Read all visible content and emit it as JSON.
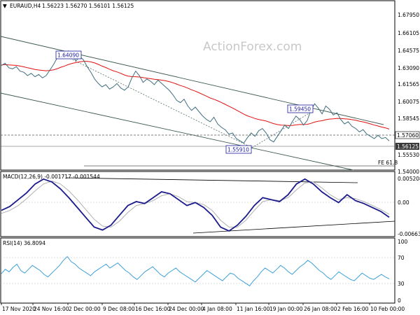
{
  "header": {
    "symbol": "EURAUD,H4",
    "ohlc": "1.56223 1.56270 1.56101 1.56125"
  },
  "watermark": "ActionForex.com",
  "colors": {
    "price": "#3f6e7e",
    "ma": "#e01010",
    "channel": "#3f5a52",
    "macd": "#1b1b8c",
    "signal": "#b0b0b0",
    "rsi": "#3ea0d8",
    "current_box": "#3a3a3a",
    "callout": "#1a1a9c"
  },
  "x_labels": [
    "17 Nov 2020",
    "24 Nov 16:00",
    "2 Dec 00:00",
    "9 Dec 08:00",
    "16 Dec 16:00",
    "24 Dec 00:00",
    "4 Jan 08:00",
    "11 Jan 16:00",
    "19 Jan 00:00",
    "26 Jan 08:00",
    "2 Feb 16:00",
    "10 Feb 00:00"
  ],
  "price_panel": {
    "y_ticks": [
      "1.67950",
      "1.66105",
      "1.64575",
      "1.63090",
      "1.61565",
      "1.60075",
      "1.58545",
      "1.57060",
      "1.56125",
      "1.55530",
      "1.54000"
    ],
    "current_price": "1.56125",
    "level_line_label": "1.57060",
    "callouts": [
      "1.64090",
      "1.59450",
      "1.55910"
    ],
    "fib_label": "FE 61.8"
  },
  "macd_panel": {
    "title": "MACD(12,26,9) -0.001717 -0.001544",
    "y_ticks": [
      "0.005208",
      "0.00",
      "-0.006631"
    ]
  },
  "rsi_panel": {
    "title": "RSI(14) 36.8094",
    "y_ticks": [
      "100",
      "70",
      "30",
      "0"
    ]
  },
  "chart_data": [
    {
      "type": "line",
      "title": "EURAUD,H4",
      "x_label_dates": [
        "17 Nov 2020",
        "24 Nov 16:00",
        "2 Dec 00:00",
        "9 Dec 08:00",
        "16 Dec 16:00",
        "24 Dec 00:00",
        "4 Jan 08:00",
        "11 Jan 16:00",
        "19 Jan 00:00",
        "26 Jan 08:00",
        "2 Feb 16:00",
        "10 Feb 00:00"
      ],
      "ylim": [
        1.535,
        1.685
      ],
      "series": [
        {
          "name": "EURAUD,H4",
          "values": [
            1.628,
            1.63,
            1.626,
            1.625,
            1.627,
            1.623,
            1.622,
            1.619,
            1.621,
            1.618,
            1.62,
            1.617,
            1.619,
            1.624,
            1.629,
            1.635,
            1.641,
            1.638,
            1.641,
            1.637,
            1.632,
            1.636,
            1.633,
            1.627,
            1.622,
            1.616,
            1.612,
            1.609,
            1.611,
            1.607,
            1.609,
            1.612,
            1.608,
            1.606,
            1.609,
            1.617,
            1.623,
            1.619,
            1.613,
            1.616,
            1.614,
            1.611,
            1.615,
            1.612,
            1.609,
            1.606,
            1.602,
            1.597,
            1.595,
            1.598,
            1.592,
            1.588,
            1.591,
            1.587,
            1.583,
            1.58,
            1.578,
            1.582,
            1.576,
            1.573,
            1.571,
            1.567,
            1.568,
            1.563,
            1.561,
            1.559,
            1.564,
            1.568,
            1.565,
            1.57,
            1.572,
            1.568,
            1.562,
            1.56,
            1.565,
            1.57,
            1.575,
            1.572,
            1.578,
            1.583,
            1.58,
            1.575,
            1.579,
            1.588,
            1.594,
            1.59,
            1.585,
            1.592,
            1.589,
            1.584,
            1.586,
            1.58,
            1.576,
            1.578,
            1.574,
            1.572,
            1.569,
            1.571,
            1.567,
            1.565,
            1.563,
            1.566,
            1.563,
            1.564,
            1.561
          ]
        },
        {
          "name": "",
          "values": [
            1.6284,
            1.6288,
            1.6285,
            1.6283,
            1.6281,
            1.6275,
            1.6268,
            1.626,
            1.6253,
            1.6245,
            1.624,
            1.6236,
            1.6233,
            1.6236,
            1.6242,
            1.6252,
            1.6265,
            1.6276,
            1.6289,
            1.6299,
            1.6306,
            1.6312,
            1.6317,
            1.6317,
            1.6312,
            1.6303,
            1.629,
            1.6275,
            1.6262,
            1.6247,
            1.6233,
            1.6223,
            1.621,
            1.6196,
            1.6186,
            1.6181,
            1.618,
            1.6178,
            1.6172,
            1.6167,
            1.6163,
            1.6157,
            1.6155,
            1.615,
            1.6144,
            1.6137,
            1.6127,
            1.6115,
            1.6102,
            1.6092,
            1.6079,
            1.6064,
            1.6052,
            1.6038,
            1.6023,
            1.6007,
            1.5991,
            1.598,
            1.5966,
            1.5951,
            1.5935,
            1.5918,
            1.5902,
            1.5884,
            1.5866,
            1.5847,
            1.5832,
            1.5821,
            1.5809,
            1.58,
            1.5794,
            1.5786,
            1.5775,
            1.5763,
            1.5755,
            1.575,
            1.5749,
            1.5746,
            1.5747,
            1.5752,
            1.5755,
            1.5755,
            1.5757,
            1.5765,
            1.5777,
            1.5785,
            1.5789,
            1.5798,
            1.5804,
            1.5806,
            1.581,
            1.5809,
            1.5806,
            1.5804,
            1.5799,
            1.5793,
            1.5785,
            1.5779,
            1.577,
            1.5761,
            1.575,
            1.5742,
            1.5733,
            1.5725,
            1.5715
          ]
        }
      ]
    },
    {
      "type": "line",
      "title": "MACD(12,26,9) -0.001717 -0.001544",
      "ylim": [
        -0.0072,
        0.0058
      ],
      "series": [
        {
          "name": "",
          "values": [
            -0.002,
            -0.0012,
            0.0002,
            0.0016,
            0.0034,
            0.0044,
            0.0038,
            0.0024,
            0.0006,
            -0.0014,
            -0.0034,
            -0.0054,
            -0.006,
            -0.005,
            -0.003,
            -0.001,
            -0.0002,
            -0.0006,
            0.0006,
            0.0018,
            0.0014,
            0.0002,
            -0.001,
            -0.0004,
            -0.0014,
            -0.003,
            -0.0054,
            -0.0062,
            -0.005,
            -0.0032,
            -0.001,
            0.0006,
            0.0002,
            -0.0002,
            0.0012,
            0.0034,
            0.0044,
            0.0034,
            0.0018,
            0.0006,
            -0.0004,
            0.0012,
            0.0,
            -0.0006,
            -0.0014,
            -0.0022,
            -0.0034
          ]
        },
        {
          "name": "",
          "values": [
            -0.0026,
            -0.002,
            -0.001,
            0.0004,
            0.002,
            0.0034,
            0.004,
            0.0034,
            0.002,
            0.0002,
            -0.0018,
            -0.0038,
            -0.0052,
            -0.0054,
            -0.0042,
            -0.0024,
            -0.001,
            -0.0006,
            0.0,
            0.001,
            0.0014,
            0.0008,
            -0.0002,
            -0.0004,
            -0.0008,
            -0.002,
            -0.004,
            -0.0054,
            -0.0054,
            -0.004,
            -0.002,
            -0.0002,
            0.0002,
            0.0,
            0.0006,
            0.0022,
            0.0036,
            0.0038,
            0.0026,
            0.0012,
            0.0002,
            0.0006,
            0.0004,
            -0.0002,
            -0.001,
            -0.0018,
            -0.0028
          ]
        }
      ]
    },
    {
      "type": "line",
      "title": "RSI(14) 36.8094",
      "ylim": [
        0,
        100
      ],
      "series": [
        {
          "name": "RSI(14)",
          "values": [
            45,
            52,
            48,
            55,
            60,
            50,
            46,
            52,
            58,
            54,
            50,
            44,
            40,
            46,
            52,
            58,
            66,
            72,
            64,
            60,
            54,
            50,
            46,
            42,
            48,
            52,
            56,
            60,
            54,
            58,
            62,
            56,
            50,
            46,
            40,
            36,
            42,
            48,
            52,
            56,
            50,
            44,
            40,
            46,
            50,
            54,
            48,
            44,
            40,
            36,
            32,
            38,
            44,
            50,
            46,
            42,
            38,
            34,
            40,
            46,
            44,
            38,
            34,
            30,
            26,
            34,
            40,
            48,
            54,
            50,
            46,
            52,
            58,
            54,
            48,
            44,
            50,
            56,
            60,
            66,
            62,
            56,
            50,
            46,
            40,
            36,
            42,
            48,
            44,
            40,
            36,
            34,
            40,
            46,
            42,
            38,
            36,
            40,
            44,
            40,
            37
          ]
        }
      ]
    }
  ]
}
